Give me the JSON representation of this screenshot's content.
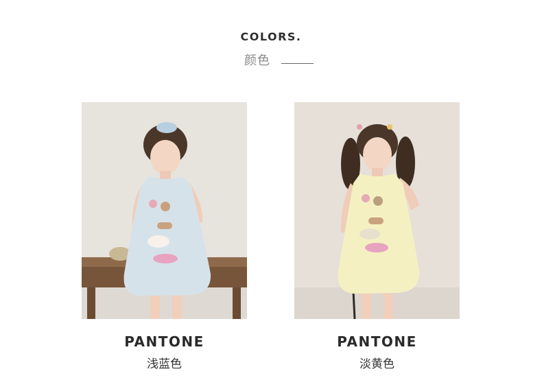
{
  "header": {
    "title": "COLORS.",
    "subtitle": "颜色"
  },
  "variants": [
    {
      "brand": "PANTONE",
      "color_name": "浅蓝色",
      "dress_color": "#d6e2ea"
    },
    {
      "brand": "PANTONE",
      "color_name": "淡黄色",
      "dress_color": "#f5f0c2"
    }
  ]
}
